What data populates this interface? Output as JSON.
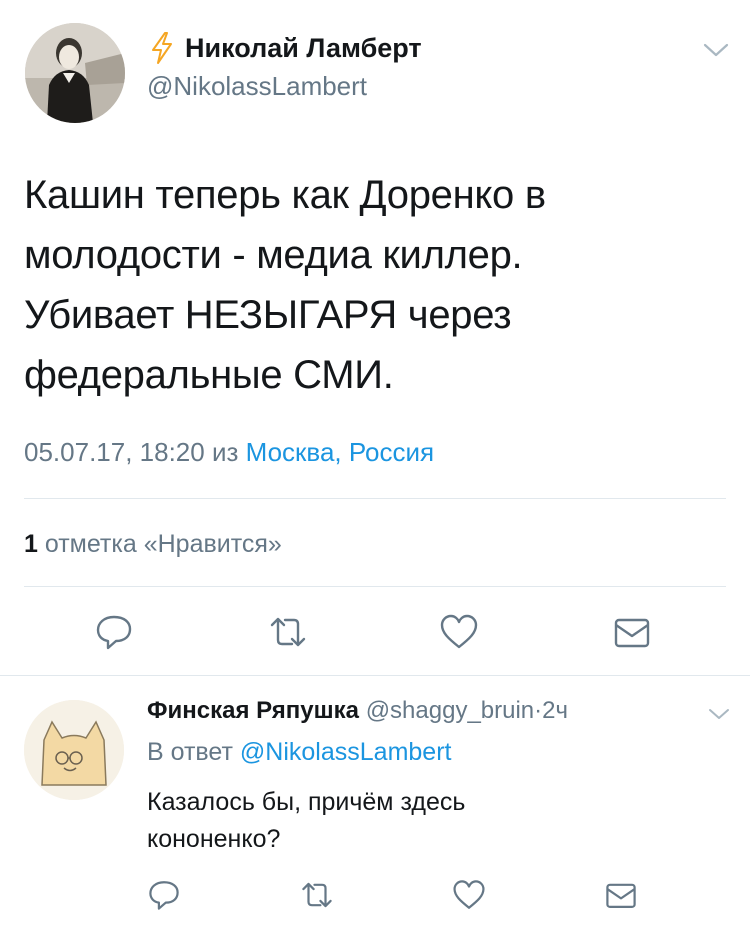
{
  "tweet": {
    "author_name": "Николай Ламберт",
    "author_handle": "@NikolassLambert",
    "text_lines": [
      "Кашин теперь как Доренко в",
      "молодости - медиа киллер.",
      "Убивает НЕЗЫГАРЯ через",
      "федеральные СМИ."
    ],
    "datetime": "05.07.17, 18:20",
    "from_word": "из",
    "location_city": "Москва",
    "location_country": "Россия",
    "likes_count": "1",
    "likes_label": "отметка «Нравится»"
  },
  "reply": {
    "author_name": "Финская Ряпушка",
    "author_handle": "@shaggy_bruin",
    "separator": "·",
    "time": "2ч",
    "reply_prefix": "В ответ",
    "reply_to_handle": "@NikolassLambert",
    "text_lines": [
      "Казалось бы, причём здесь",
      "кононенко?"
    ]
  },
  "icons": {
    "verified_bolt": "lightning-bolt-icon",
    "menu": "chevron-down-icon",
    "reply": "reply-icon",
    "retweet": "retweet-icon",
    "like": "heart-icon",
    "dm": "envelope-icon"
  },
  "colors": {
    "text": "#14171a",
    "secondary": "#657786",
    "link": "#1b95e0",
    "divider": "#e1e8ed",
    "bolt": "#f5a623"
  }
}
